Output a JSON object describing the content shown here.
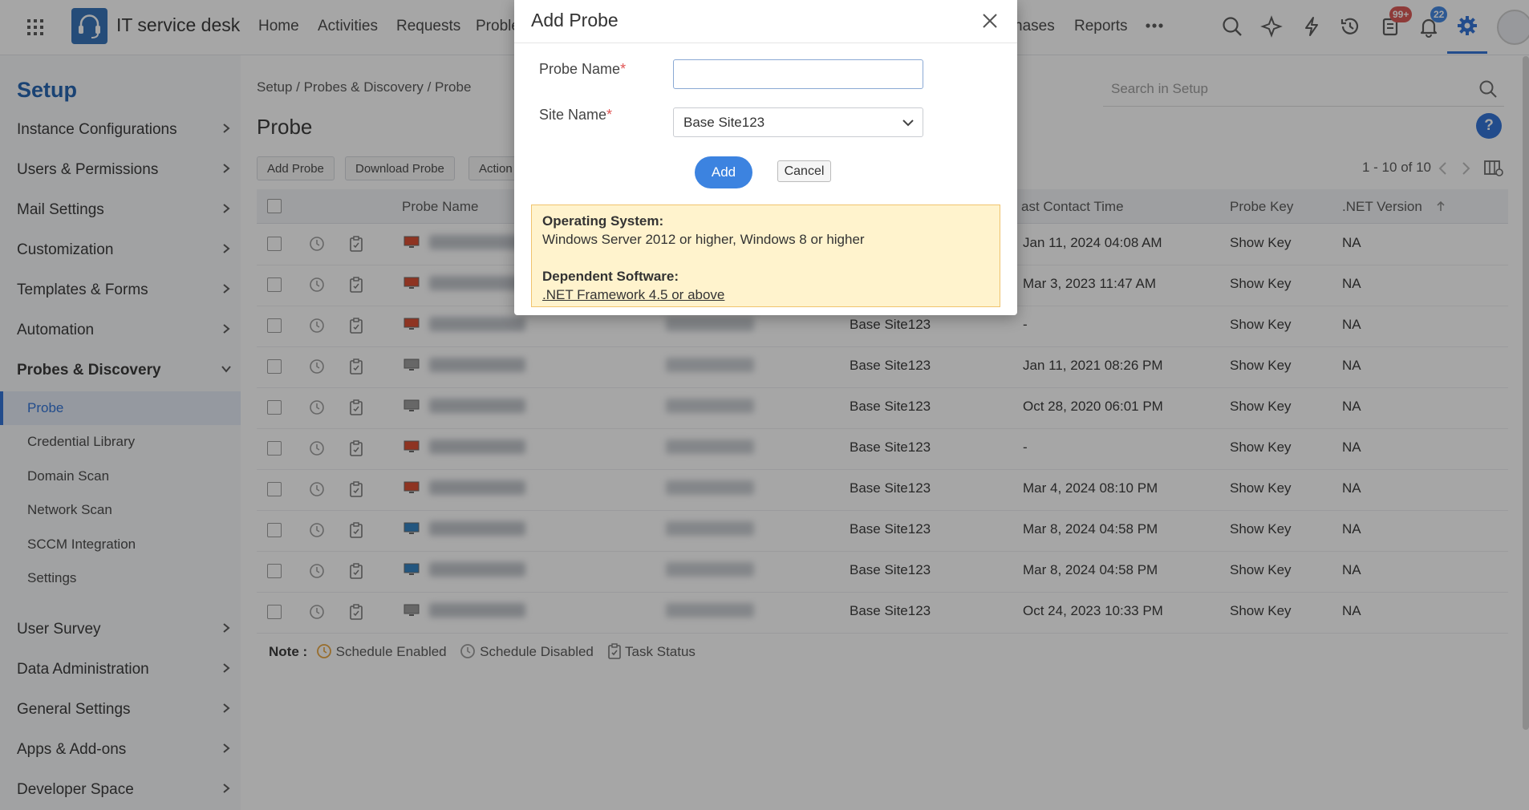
{
  "app": {
    "title": "IT service desk"
  },
  "nav": [
    "Home",
    "Activities",
    "Requests",
    "Proble",
    "hases",
    "Reports"
  ],
  "badges": {
    "notes": "99+",
    "notifications": "22"
  },
  "sidebar": {
    "title": "Setup",
    "items": [
      "Instance Configurations",
      "Users & Permissions",
      "Mail Settings",
      "Customization",
      "Templates & Forms",
      "Automation",
      "Probes & Discovery"
    ],
    "sub_items": [
      "Probe",
      "Credential Library",
      "Domain Scan",
      "Network Scan",
      "SCCM Integration",
      "Settings"
    ],
    "bottom_items": [
      "User Survey",
      "Data Administration",
      "General Settings",
      "Apps & Add-ons",
      "Developer Space"
    ]
  },
  "main": {
    "breadcrumb": "Setup / Probes & Discovery / Probe",
    "title": "Probe",
    "search_placeholder": "Search in Setup",
    "help": "?",
    "toolbar": {
      "add": "Add Probe",
      "download": "Download Probe",
      "actions": "Action"
    },
    "pager": "1 - 10 of 10",
    "columns": {
      "probe_name": "Probe Name",
      "last_contact": "ast Contact Time",
      "probe_key": "Probe Key",
      "net_version": ".NET Version"
    },
    "rows": [
      {
        "site": "",
        "last_contact": "Jan 11, 2024 04:08 AM",
        "key": "Show Key",
        "net": "NA",
        "monitor": "red"
      },
      {
        "site": "",
        "last_contact": "Mar 3, 2023 11:47 AM",
        "key": "Show Key",
        "net": "NA",
        "monitor": "red"
      },
      {
        "site": "Base Site123",
        "last_contact": "-",
        "key": "Show Key",
        "net": "NA",
        "monitor": "red"
      },
      {
        "site": "Base Site123",
        "last_contact": "Jan 11, 2021 08:26 PM",
        "key": "Show Key",
        "net": "NA",
        "monitor": "gray"
      },
      {
        "site": "Base Site123",
        "last_contact": "Oct 28, 2020 06:01 PM",
        "key": "Show Key",
        "net": "NA",
        "monitor": "gray"
      },
      {
        "site": "Base Site123",
        "last_contact": "-",
        "key": "Show Key",
        "net": "NA",
        "monitor": "red"
      },
      {
        "site": "Base Site123",
        "last_contact": "Mar 4, 2024 08:10 PM",
        "key": "Show Key",
        "net": "NA",
        "monitor": "red"
      },
      {
        "site": "Base Site123",
        "last_contact": "Mar 8, 2024 04:58 PM",
        "key": "Show Key",
        "net": "NA",
        "monitor": "blue"
      },
      {
        "site": "Base Site123",
        "last_contact": "Mar 8, 2024 04:58 PM",
        "key": "Show Key",
        "net": "NA",
        "monitor": "blue"
      },
      {
        "site": "Base Site123",
        "last_contact": "Oct 24, 2023 10:33 PM",
        "key": "Show Key",
        "net": "NA",
        "monitor": "gray"
      }
    ],
    "note": {
      "label": "Note :",
      "enabled": "Schedule Enabled",
      "disabled": "Schedule Disabled",
      "task": "Task Status"
    }
  },
  "dialog": {
    "title": "Add Probe",
    "probe_name_label": "Probe Name",
    "site_name_label": "Site Name",
    "required_mark": "*",
    "probe_name_value": "",
    "site_name_value": "Base Site123",
    "add_label": "Add",
    "cancel_label": "Cancel",
    "os_heading": "Operating System:",
    "os_text": "Windows Server 2012 or higher, Windows 8 or higher",
    "sw_heading": "Dependent Software:",
    "sw_link": ".NET Framework 4.5 or above"
  },
  "colors": {
    "accent": "#2b6fd6",
    "monitor_red": "#d9472b",
    "monitor_blue": "#2d7fc1",
    "monitor_gray": "#9a9a9a"
  }
}
